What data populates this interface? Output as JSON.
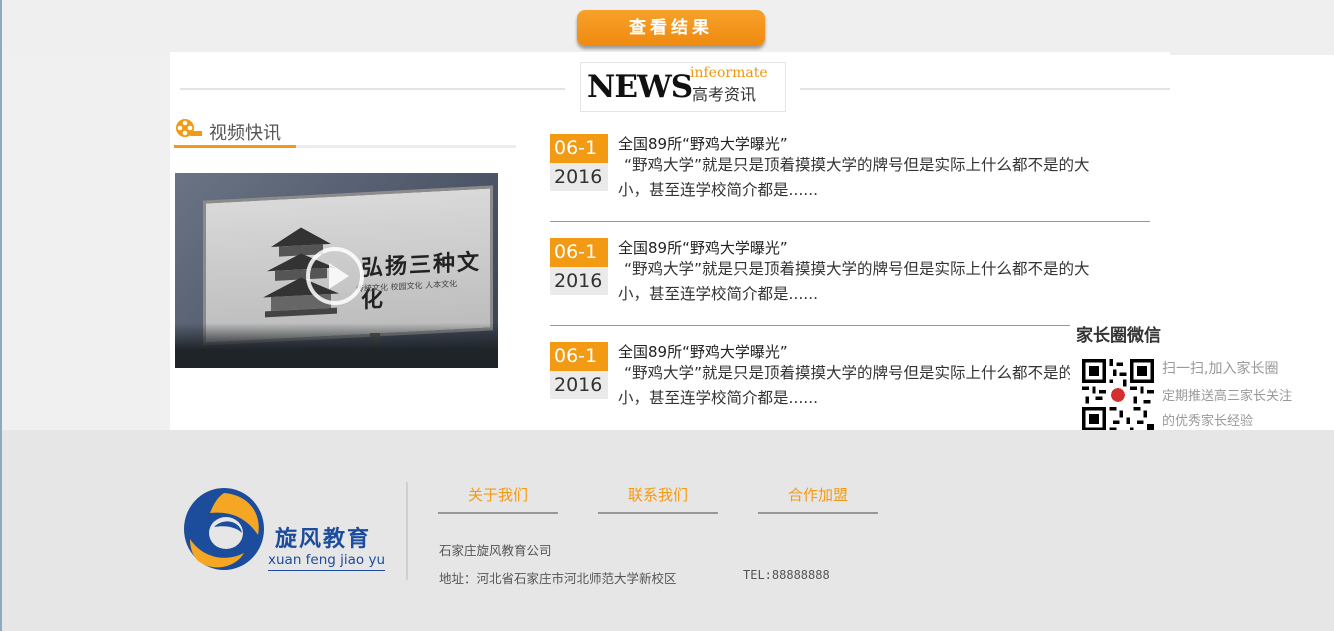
{
  "top": {
    "result_button": "查看结果"
  },
  "news_header": {
    "word": "NEWS",
    "english": "infeormate",
    "chinese": "高考资讯"
  },
  "video": {
    "title": "视频快讯",
    "icon": "film-reel-icon",
    "thumbnail": {
      "billboard_text": "弘扬三种文化",
      "billboard_subtext": "传统文化  校园文化  人本文化",
      "play_icon": "play-icon"
    }
  },
  "news_items": [
    {
      "day": "06-1",
      "year": "2016",
      "title": "全国89所“野鸡大学曝光”",
      "desc": "“野鸡大学”就是只是顶着摸摸大学的牌号但是实际上什么都不是的大小，甚至连学校简介都是......"
    },
    {
      "day": "06-1",
      "year": "2016",
      "title": "全国89所“野鸡大学曝光”",
      "desc": "“野鸡大学”就是只是顶着摸摸大学的牌号但是实际上什么都不是的大小，甚至连学校简介都是......"
    },
    {
      "day": "06-1",
      "year": "2016",
      "title": "全国89所“野鸡大学曝光”",
      "desc": "“野鸡大学”就是只是顶着摸摸大学的牌号但是实际上什么都不是的大小，甚至连学校简介都是......"
    }
  ],
  "wechat": {
    "title": "家长圈微信",
    "line1": "扫一扫,加入家长圈",
    "line2": "定期推送高三家长关注",
    "line3": "的优秀家长经验",
    "qr_icon": "qr-code-icon"
  },
  "footer": {
    "logo_cn": "旋风教育",
    "logo_en": "xuan feng jiao yu",
    "links": [
      "关于我们",
      "联系我们",
      "合作加盟"
    ],
    "company": "石家庄旋风教育公司",
    "address": "地址：河北省石家庄市河北师范大学新校区",
    "tel": "TEL:88888888"
  },
  "colors": {
    "accent": "#f39a14",
    "brand_blue": "#1c4c9c",
    "footer_bg": "#e6e6e6"
  }
}
